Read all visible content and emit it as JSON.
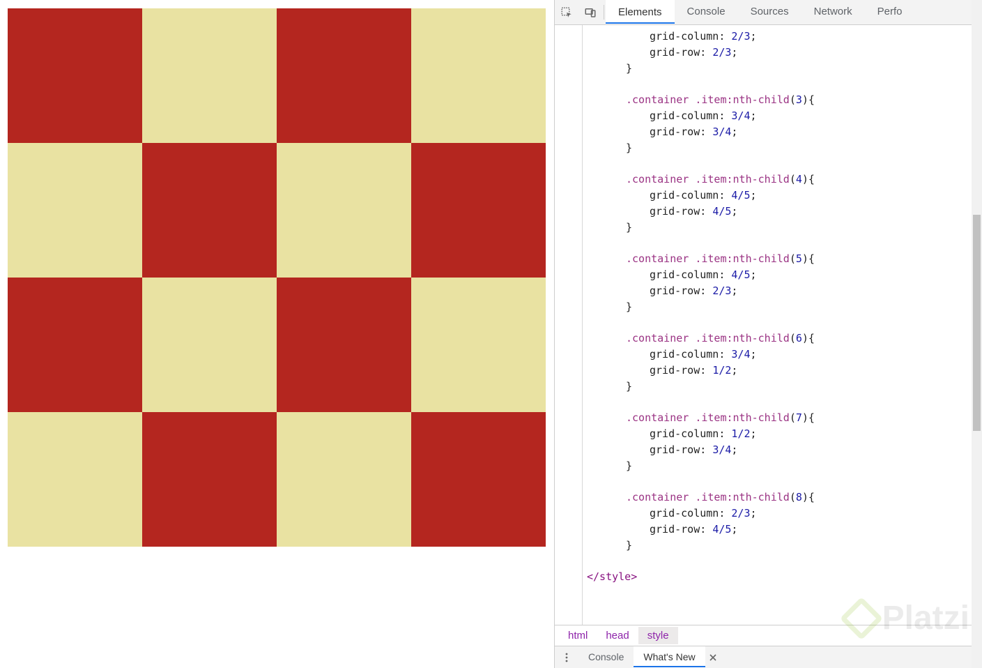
{
  "devtools": {
    "tabs": [
      "Elements",
      "Console",
      "Sources",
      "Network",
      "Perfo"
    ],
    "active_tab": 0,
    "breadcrumb": [
      "html",
      "head",
      "style"
    ],
    "breadcrumb_active": 2,
    "drawer": {
      "tabs": [
        "Console",
        "What's New"
      ],
      "active": 1
    }
  },
  "code": {
    "indent": "        ",
    "pre_rule": {
      "decls": [
        {
          "prop": "grid-column",
          "val": "2/3"
        },
        {
          "prop": "grid-row",
          "val": "2/3"
        }
      ]
    },
    "rules": [
      {
        "selector_class": ".container",
        "selector_item": ".item",
        "pseudo": ":nth-child",
        "n": "3",
        "decls": [
          {
            "prop": "grid-column",
            "val": "3/4"
          },
          {
            "prop": "grid-row",
            "val": "3/4"
          }
        ]
      },
      {
        "selector_class": ".container",
        "selector_item": ".item",
        "pseudo": ":nth-child",
        "n": "4",
        "decls": [
          {
            "prop": "grid-column",
            "val": "4/5"
          },
          {
            "prop": "grid-row",
            "val": "4/5"
          }
        ]
      },
      {
        "selector_class": ".container",
        "selector_item": ".item",
        "pseudo": ":nth-child",
        "n": "5",
        "decls": [
          {
            "prop": "grid-column",
            "val": "4/5"
          },
          {
            "prop": "grid-row",
            "val": "2/3"
          }
        ]
      },
      {
        "selector_class": ".container",
        "selector_item": ".item",
        "pseudo": ":nth-child",
        "n": "6",
        "decls": [
          {
            "prop": "grid-column",
            "val": "3/4"
          },
          {
            "prop": "grid-row",
            "val": "1/2"
          }
        ]
      },
      {
        "selector_class": ".container",
        "selector_item": ".item",
        "pseudo": ":nth-child",
        "n": "7",
        "decls": [
          {
            "prop": "grid-column",
            "val": "1/2"
          },
          {
            "prop": "grid-row",
            "val": "3/4"
          }
        ]
      },
      {
        "selector_class": ".container",
        "selector_item": ".item",
        "pseudo": ":nth-child",
        "n": "8",
        "decls": [
          {
            "prop": "grid-column",
            "val": "2/3"
          },
          {
            "prop": "grid-row",
            "val": "4/5"
          }
        ]
      }
    ],
    "closing_tag": "</style>"
  },
  "checker": {
    "rows": 4,
    "cols": 4,
    "colors": {
      "a": "#b4261f",
      "b": "#e9e2a2"
    },
    "pattern": [
      [
        "a",
        "b",
        "a",
        "b"
      ],
      [
        "b",
        "a",
        "b",
        "a"
      ],
      [
        "a",
        "b",
        "a",
        "b"
      ],
      [
        "b",
        "a",
        "b",
        "a"
      ]
    ]
  },
  "watermark": "Platzi"
}
